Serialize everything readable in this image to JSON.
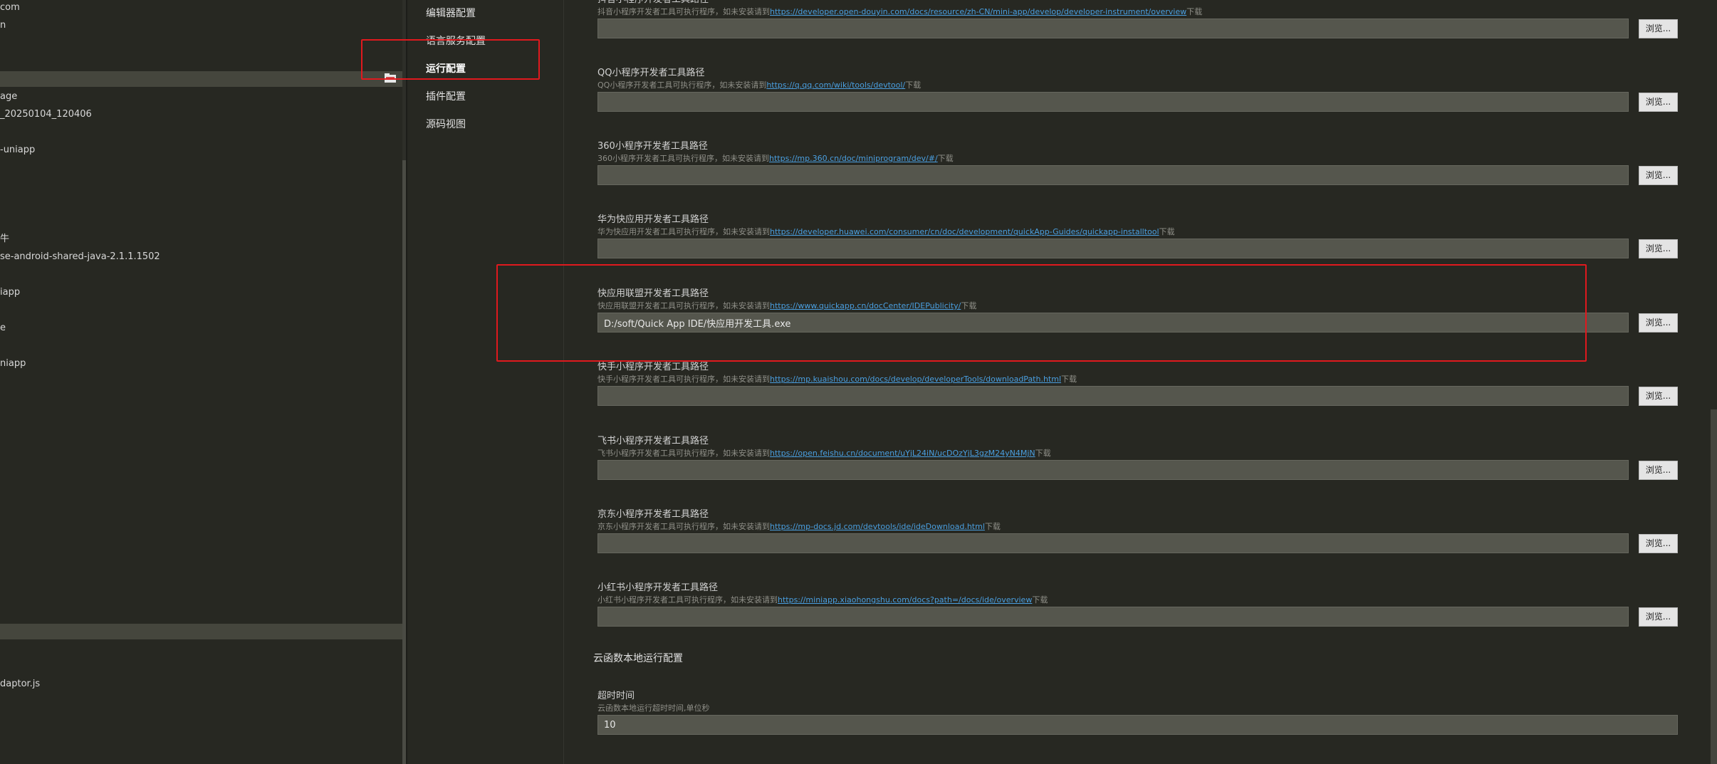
{
  "file_tree": {
    "items": [
      "com",
      "n",
      "age",
      "_20250104_120406",
      "-uniapp",
      "牛",
      "se-android-shared-java-2.1.1.1502",
      "iapp",
      "e",
      "niapp",
      "daptor.js"
    ]
  },
  "nav": {
    "items": [
      "编辑器配置",
      "语言服务配置",
      "运行配置",
      "插件配置",
      "源码视图"
    ]
  },
  "settings": {
    "desc_prefix": "可执行程序，如未安装请到",
    "download_label": "下载",
    "browse_label": "浏览...",
    "tools": [
      {
        "title": "抖音小程序开发者工具路径",
        "desc_name": "抖音小程序开发者工具可执行程序，如未安装请到",
        "link": "https://developer.open-douyin.com/docs/resource/zh-CN/mini-app/develop/developer-instrument/overview",
        "value": ""
      },
      {
        "title": "QQ小程序开发者工具路径",
        "desc_name": "QQ小程序开发者工具可执行程序，如未安装请到",
        "link": "https://q.qq.com/wiki/tools/devtool/",
        "value": ""
      },
      {
        "title": "360小程序开发者工具路径",
        "desc_name": "360小程序开发者工具可执行程序，如未安装请到",
        "link": "https://mp.360.cn/doc/miniprogram/dev/#/",
        "value": ""
      },
      {
        "title": "华为快应用开发者工具路径",
        "desc_name": "华为快应用开发者工具可执行程序，如未安装请到",
        "link": "https://developer.huawei.com/consumer/cn/doc/development/quickApp-Guides/quickapp-installtool",
        "value": ""
      },
      {
        "title": "快应用联盟开发者工具路径",
        "desc_name": "快应用联盟开发者工具可执行程序，如未安装请到",
        "link": "https://www.quickapp.cn/docCenter/IDEPublicity/",
        "value": "D:/soft/Quick App IDE/快应用开发工具.exe"
      },
      {
        "title": "快手小程序开发者工具路径",
        "desc_name": "快手小程序开发者工具可执行程序，如未安装请到",
        "link": "https://mp.kuaishou.com/docs/develop/developerTools/downloadPath.html",
        "value": ""
      },
      {
        "title": "飞书小程序开发者工具路径",
        "desc_name": "飞书小程序开发者工具可执行程序，如未安装请到",
        "link": "https://open.feishu.cn/document/uYjL24iN/ucDOzYjL3gzM24yN4MjN",
        "value": ""
      },
      {
        "title": "京东小程序开发者工具路径",
        "desc_name": "京东小程序开发者工具可执行程序，如未安装请到",
        "link": "https://mp-docs.jd.com/devtools/ide/ideDownload.html",
        "value": ""
      },
      {
        "title": "小红书小程序开发者工具路径",
        "desc_name": "小红书小程序开发者工具可执行程序，如未安装请到",
        "link": "https://miniapp.xiaohongshu.com/docs?path=/docs/ide/overview",
        "value": ""
      }
    ],
    "cloud_section": {
      "heading": "云函数本地运行配置",
      "timeout_title": "超时时间",
      "timeout_desc": "云函数本地运行超时时间,单位秒",
      "timeout_value": "10"
    }
  },
  "colors": {
    "background": "#272822",
    "annotation": "#e0191e",
    "link": "#4a9fe0"
  }
}
